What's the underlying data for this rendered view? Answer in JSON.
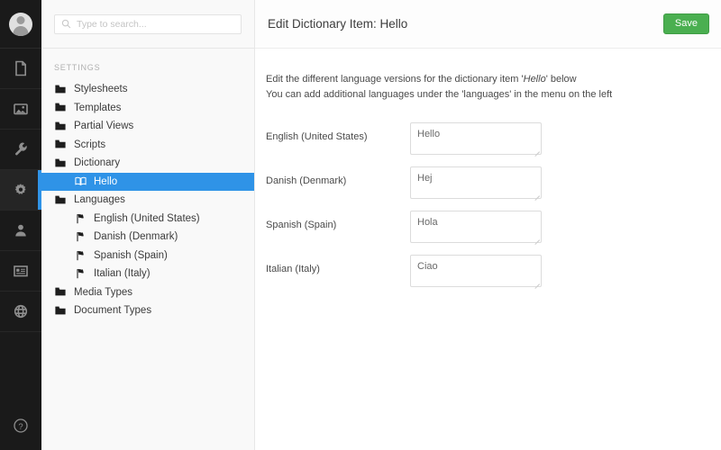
{
  "rail": {
    "avatar_name": "user-avatar",
    "items": [
      {
        "name": "content-icon",
        "label": "Content",
        "active": false
      },
      {
        "name": "media-icon",
        "label": "Media",
        "active": false
      },
      {
        "name": "settings-wrench-icon",
        "label": "Settings",
        "active": false
      },
      {
        "name": "gear-icon",
        "label": "Developer",
        "active": true
      },
      {
        "name": "users-icon",
        "label": "Users",
        "active": false
      },
      {
        "name": "forms-icon",
        "label": "Forms",
        "active": false
      },
      {
        "name": "translation-globe-icon",
        "label": "Translation",
        "active": false
      }
    ],
    "help_label": "Help"
  },
  "search": {
    "placeholder": "Type to search...",
    "value": "",
    "icon": "search-icon"
  },
  "sidebar": {
    "heading": "SETTINGS",
    "items": [
      {
        "label": "Stylesheets",
        "level": 1,
        "icon": "folder-icon",
        "selected": false
      },
      {
        "label": "Templates",
        "level": 1,
        "icon": "folder-icon",
        "selected": false
      },
      {
        "label": "Partial Views",
        "level": 1,
        "icon": "folder-icon",
        "selected": false
      },
      {
        "label": "Scripts",
        "level": 1,
        "icon": "folder-icon",
        "selected": false
      },
      {
        "label": "Dictionary",
        "level": 1,
        "icon": "folder-icon",
        "selected": false
      },
      {
        "label": "Hello",
        "level": 2,
        "icon": "book-icon",
        "selected": true
      },
      {
        "label": "Languages",
        "level": 1,
        "icon": "folder-icon",
        "selected": false
      },
      {
        "label": "English (United States)",
        "level": 2,
        "icon": "flag-icon",
        "selected": false
      },
      {
        "label": "Danish (Denmark)",
        "level": 2,
        "icon": "flag-icon",
        "selected": false
      },
      {
        "label": "Spanish (Spain)",
        "level": 2,
        "icon": "flag-icon",
        "selected": false
      },
      {
        "label": "Italian (Italy)",
        "level": 2,
        "icon": "flag-icon",
        "selected": false
      },
      {
        "label": "Media Types",
        "level": 1,
        "icon": "folder-icon",
        "selected": false
      },
      {
        "label": "Document Types",
        "level": 1,
        "icon": "folder-icon",
        "selected": false
      }
    ]
  },
  "header": {
    "title": "Edit Dictionary Item: Hello",
    "save_label": "Save"
  },
  "main": {
    "intro_line1_before": "Edit the different language versions for the dictionary item '",
    "intro_line1_em": "Hello",
    "intro_line1_after": "' below",
    "intro_line2": "You can add additional languages under the 'languages' in the menu on the left",
    "fields": [
      {
        "label": "English (United States)",
        "value": "Hello"
      },
      {
        "label": "Danish (Denmark)",
        "value": "Hej"
      },
      {
        "label": "Spanish (Spain)",
        "value": "Hola"
      },
      {
        "label": "Italian (Italy)",
        "value": "Ciao"
      }
    ]
  },
  "colors": {
    "accent_blue": "#2f93e7",
    "save_green": "#4aaf50",
    "rail_dark": "#1a1a1a",
    "sidebar_bg": "#f9f9f9"
  }
}
